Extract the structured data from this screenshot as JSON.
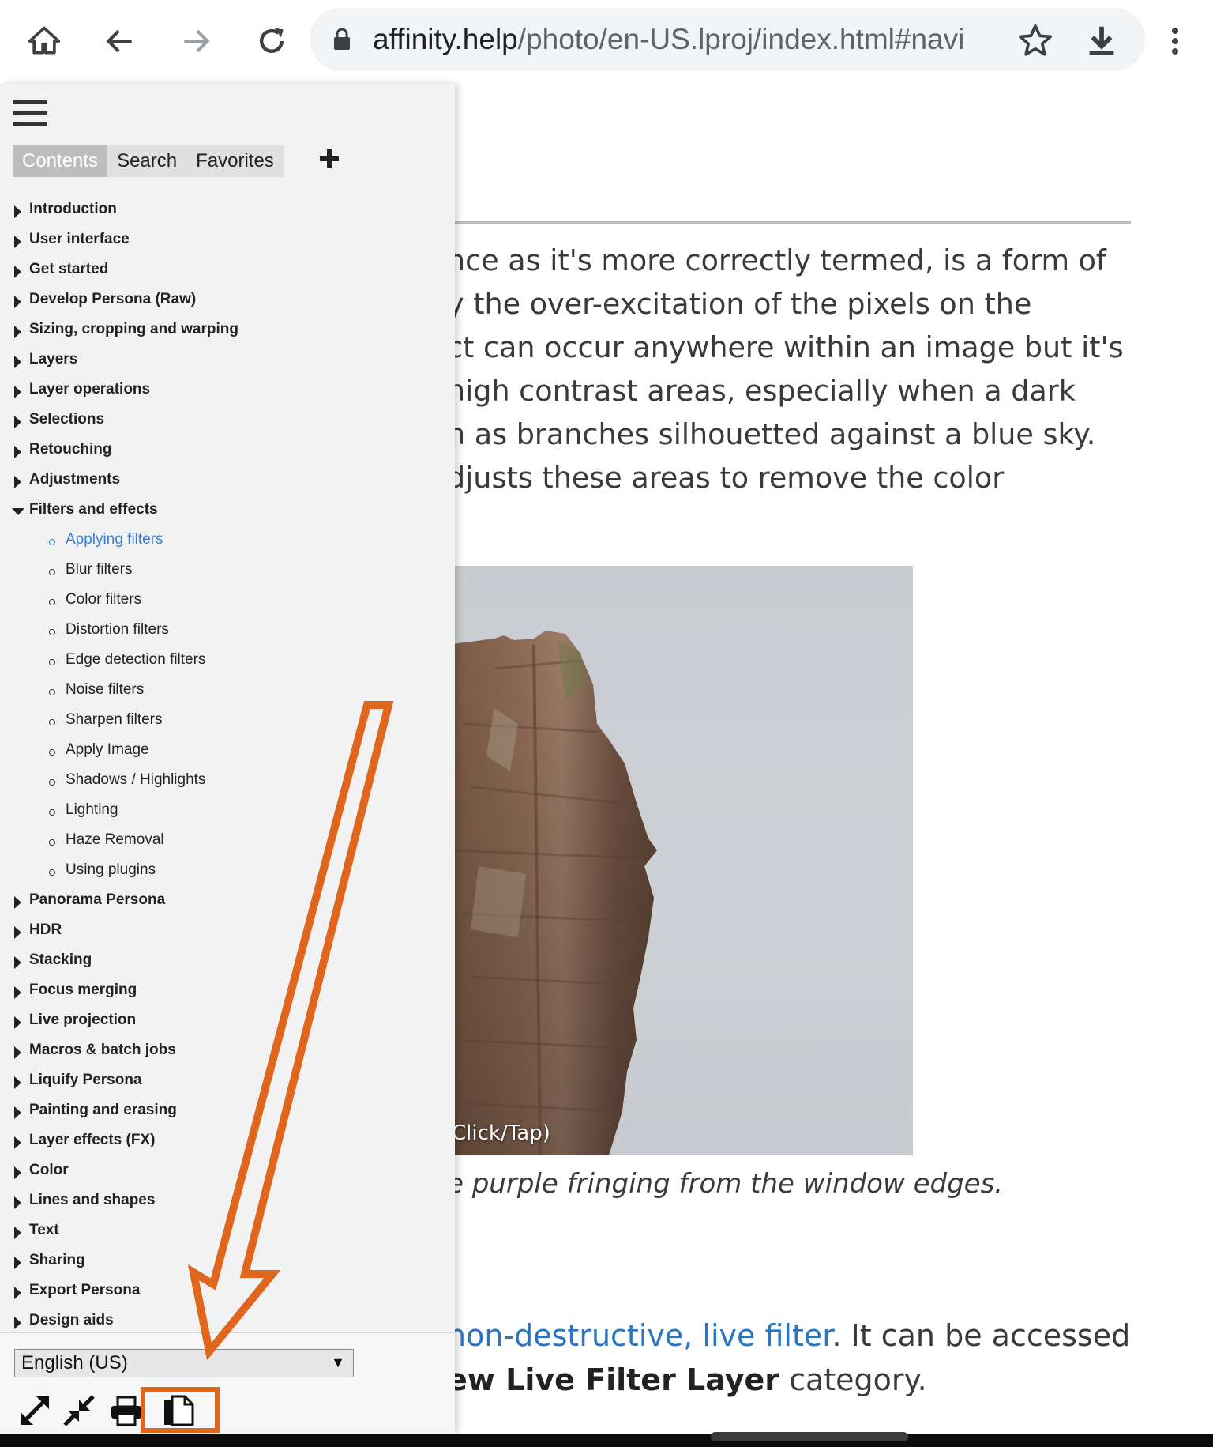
{
  "browser": {
    "url_host": "affinity.help",
    "url_path": "/photo/en-US.lproj/index.html#navi",
    "icons": [
      "home-icon",
      "back-icon",
      "forward-icon",
      "reload-icon",
      "lock-icon",
      "star-icon",
      "download-icon",
      "more-icon"
    ]
  },
  "sidebar": {
    "tabs": [
      {
        "label": "Contents"
      },
      {
        "label": "Search"
      },
      {
        "label": "Favorites"
      }
    ],
    "toc": [
      {
        "label": "Introduction"
      },
      {
        "label": "User interface"
      },
      {
        "label": "Get started"
      },
      {
        "label": "Develop Persona (Raw)"
      },
      {
        "label": "Sizing, cropping and warping"
      },
      {
        "label": "Layers"
      },
      {
        "label": "Layer operations"
      },
      {
        "label": "Selections"
      },
      {
        "label": "Retouching"
      },
      {
        "label": "Adjustments"
      },
      {
        "label": "Filters and effects"
      },
      {
        "label": "Panorama Persona"
      },
      {
        "label": "HDR"
      },
      {
        "label": "Stacking"
      },
      {
        "label": "Focus merging"
      },
      {
        "label": "Live projection"
      },
      {
        "label": "Macros & batch jobs"
      },
      {
        "label": "Liquify Persona"
      },
      {
        "label": "Painting and erasing"
      },
      {
        "label": "Layer effects (FX)"
      },
      {
        "label": "Color"
      },
      {
        "label": "Lines and shapes"
      },
      {
        "label": "Text"
      },
      {
        "label": "Sharing"
      },
      {
        "label": "Export Persona"
      },
      {
        "label": "Design aids"
      }
    ],
    "subitems": [
      {
        "label": "Applying filters"
      },
      {
        "label": "Blur filters"
      },
      {
        "label": "Color filters"
      },
      {
        "label": "Distortion filters"
      },
      {
        "label": "Edge detection filters"
      },
      {
        "label": "Noise filters"
      },
      {
        "label": "Sharpen filters"
      },
      {
        "label": "Apply Image"
      },
      {
        "label": "Shadows / Highlights"
      },
      {
        "label": "Lighting"
      },
      {
        "label": "Haze Removal"
      },
      {
        "label": "Using plugins"
      }
    ],
    "language": "English (US)",
    "footer_icons": [
      "expand-all-icon",
      "collapse-all-icon",
      "print-icon",
      "print-section-icon"
    ]
  },
  "article": {
    "lines": [
      "nce as it's more correctly termed, is a form of",
      "y the over-excitation of the pixels on the",
      "ct can occur anywhere within an image but it's",
      "high contrast areas, especially when a dark",
      "h as branches silhouetted against a blue sky.",
      "djusts these areas to remove the color"
    ],
    "photo_caption": "Click/Tap)",
    "figure_caption": "e purple fringing from the window edges.",
    "para2_link": "non-destructive, live filter",
    "para2_rest1": ". It can be accessed",
    "para2_bold": "ew Live Filter Layer",
    "para2_rest2": " category."
  },
  "colors": {
    "annotation": "#e0661d",
    "link": "#2a76c4"
  }
}
